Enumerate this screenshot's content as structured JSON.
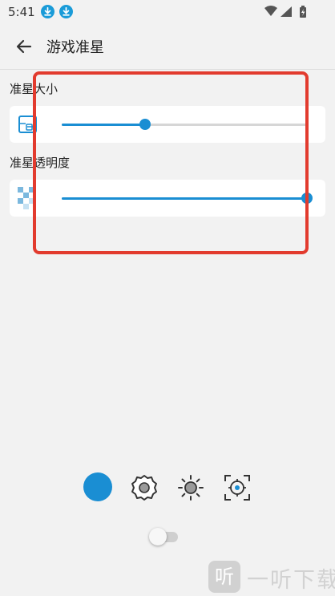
{
  "status_bar": {
    "time": "5:41",
    "icons": [
      "download-icon",
      "download-icon",
      "wifi-icon",
      "signal-icon",
      "battery-icon"
    ]
  },
  "app_bar": {
    "back_icon": "back-arrow-icon",
    "title": "游戏准星"
  },
  "settings": {
    "size": {
      "label": "准星大小",
      "icon": "crosshair-size-icon",
      "value_fraction": 0.34
    },
    "opacity": {
      "label": "准星透明度",
      "icon": "transparency-checker-icon",
      "value_fraction": 1.0
    }
  },
  "bottom_toolbar": {
    "items": [
      "color-picker",
      "settings-gear-icon",
      "brightness-icon",
      "crosshair-target-icon"
    ],
    "selected_color": "#1a8ed3"
  },
  "toggle": {
    "on": false
  },
  "watermark": {
    "logo_char": "听",
    "text": "一听下载"
  },
  "colors": {
    "accent": "#1a8ed3",
    "highlight": "#e23b2e",
    "background": "#f2f2f2"
  }
}
